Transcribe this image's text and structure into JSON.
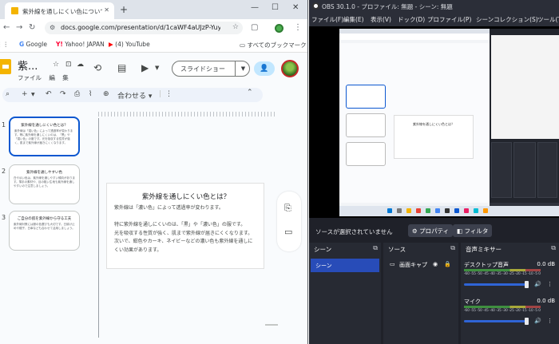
{
  "browser": {
    "tab_title": "紫外線を通しにくい色について - G",
    "url": "docs.google.com/presentation/d/1caWF4aUJzP-Yuymi...",
    "bookmarks": [
      "Google",
      "Yahoo! JAPAN",
      "(4) YouTube",
      "すべてのブックマーク"
    ]
  },
  "slides_app": {
    "doc_title": "紫...",
    "menu": [
      "ファイル",
      "編",
      "集"
    ],
    "slideshow_label": "スライドショー",
    "zoom_label": "合わせる",
    "thumbnails": [
      {
        "num": "1",
        "title": "紫外線を通しにくい色とは？",
        "body": "紫外線は「濃い色」によって透過率が変わります。等に紫外線を通しにくいのは、「黒」や「濃い色」の服です。光を吸収する性質が強く、肌まで紫外線が届きにくくなります。"
      },
      {
        "num": "2",
        "title": "紫外線を通しやすい色",
        "body": "白や淡い色は、紫外線を通しやすい傾向があります。薄手の素材や、目の粗い生地も紫外線を通しやすいので注意しましょう。"
      },
      {
        "num": "3",
        "title": "ご自分の肌を紫外線から守る工夫",
        "body": "紫外線対策には服の色選びも大切です。日焼け止めや帽子、日傘なども合わせて活用しましょう。"
      }
    ],
    "slide": {
      "title": "紫外線を通しにくい色とは？",
      "lines": [
        "紫外線は「濃い色」によって透過率が変わります。",
        "",
        "特に紫外線を通しにくいのは、「黒」や「濃い色」の服です。",
        "光を吸収する性質が強く、肌まで紫外線が届きにくくなります。",
        "次いで、紺色やカーキ、ネイビーなどの濃い色も紫外線を通しに",
        "くい効果があります。"
      ]
    }
  },
  "obs": {
    "window_title": "OBS 30.1.0 - プロファイル: 無題 - シーン: 無題",
    "menu": [
      "ファイル(F)",
      "編集(E)",
      "表示(V)",
      "ドック(D)",
      "プロファイル(P)",
      "シーンコレクション(S)",
      "ツール(T)",
      "ヘ"
    ],
    "no_source_text": "ソースが選択されていません",
    "properties_label": "プロパティ",
    "filters_label": "フィルタ",
    "scenes_header": "シーン",
    "scene_item": "シーン",
    "sources_header": "ソース",
    "source_item": "画面キャプ",
    "mixer_header": "音声ミキサー",
    "mixer": [
      {
        "name": "デスクトップ音声",
        "db": "0.0 dB"
      },
      {
        "name": "マイク",
        "db": "0.0 dB"
      }
    ],
    "meter_ticks": "-60 -55 -50 -45 -40 -35 -30 -25 -20 -15 -10 -5 0"
  },
  "colors": {
    "accent_blue": "#0b57d0",
    "obs_bg": "#1f2129",
    "scene_selected": "#284cb8",
    "slides_yellow": "#f4b400"
  }
}
